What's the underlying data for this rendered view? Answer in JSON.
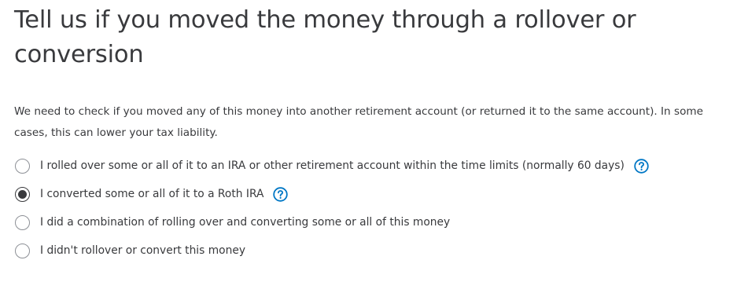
{
  "header": {
    "title": "Tell us if you moved the money through a rollover or conversion"
  },
  "main": {
    "description": "We need to check if you moved any of this money into another retirement account (or returned it to the same account). In some cases, this can lower your tax liability.",
    "options": [
      {
        "label": "I rolled over some or all of it to an IRA or other retirement account within the time limits (normally 60 days)",
        "selected": false,
        "help_icon": "question-circle-icon"
      },
      {
        "label": "I converted some or all of it to a Roth IRA",
        "selected": true,
        "help_icon": "question-circle-icon"
      },
      {
        "label": "I did a combination of rolling over and converting some or all of this money",
        "selected": false
      },
      {
        "label": "I didn't rollover or convert this money",
        "selected": false
      }
    ]
  },
  "colors": {
    "text": "#393a3d",
    "radio_border": "#8d9096",
    "help_icon": "#0077c5"
  }
}
